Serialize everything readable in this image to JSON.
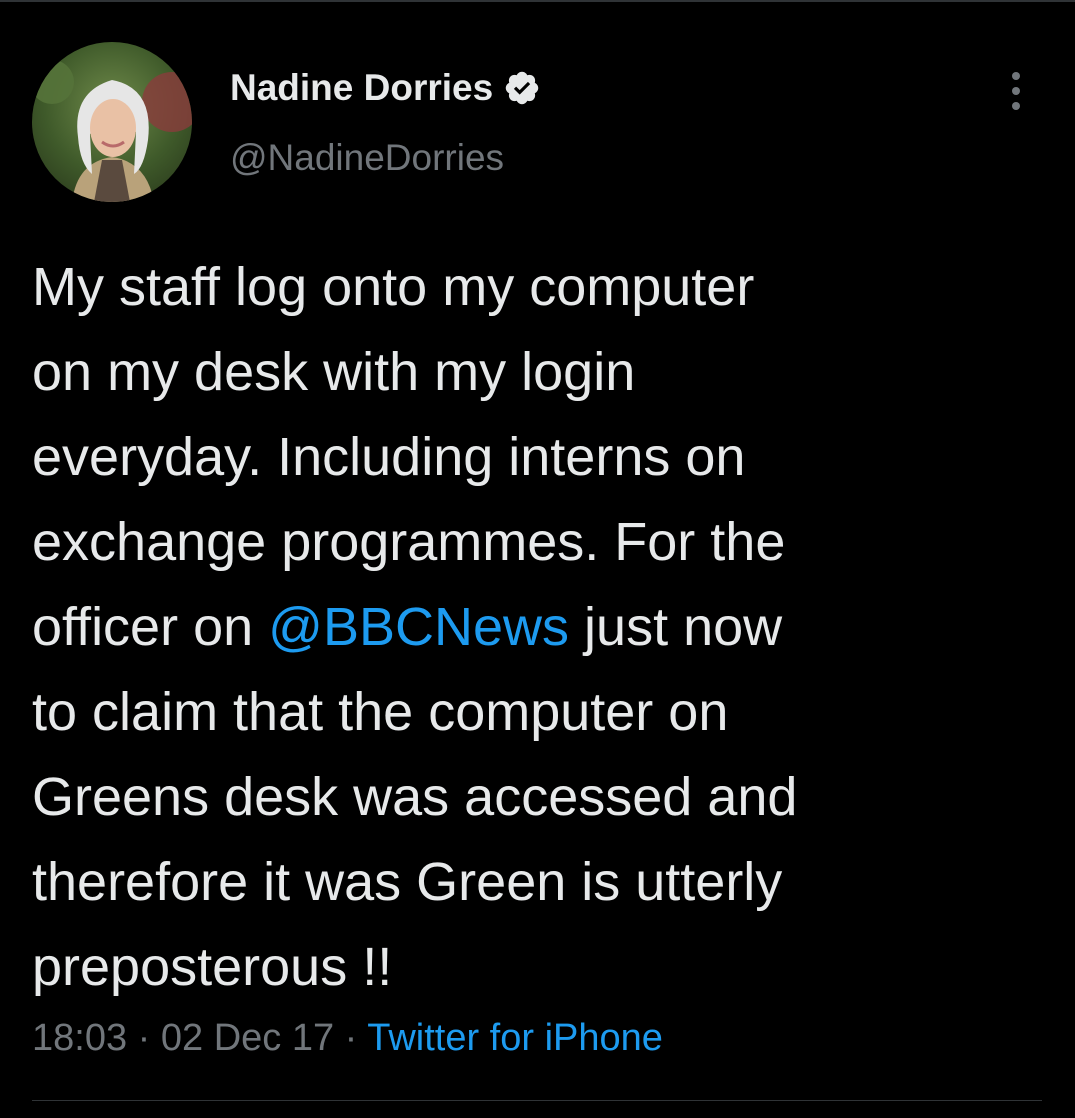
{
  "author": {
    "display_name": "Nadine Dorries",
    "handle": "@NadineDorries",
    "verified": true
  },
  "tweet": {
    "line1": "My staff log onto my computer",
    "line2": "on my desk with my login",
    "line3": "everyday. Including interns on",
    "line4": "exchange programmes. For the",
    "line5_before": "officer on ",
    "line5_mention": "@BBCNews",
    "line5_after": " just now",
    "line6": "to claim that the computer on",
    "line7": "Greens desk was accessed and",
    "line8": "therefore it was Green is utterly",
    "line9": "preposterous !!"
  },
  "meta": {
    "time": "18:03",
    "separator1": " · ",
    "date": "02 Dec 17",
    "separator2": " · ",
    "source": "Twitter for iPhone"
  },
  "icons": {
    "verified": "verified-badge-icon",
    "more": "more-vertical-icon"
  },
  "colors": {
    "background": "#000000",
    "text": "#e7e9ea",
    "secondary": "#71767b",
    "accent": "#1d9bf0"
  }
}
